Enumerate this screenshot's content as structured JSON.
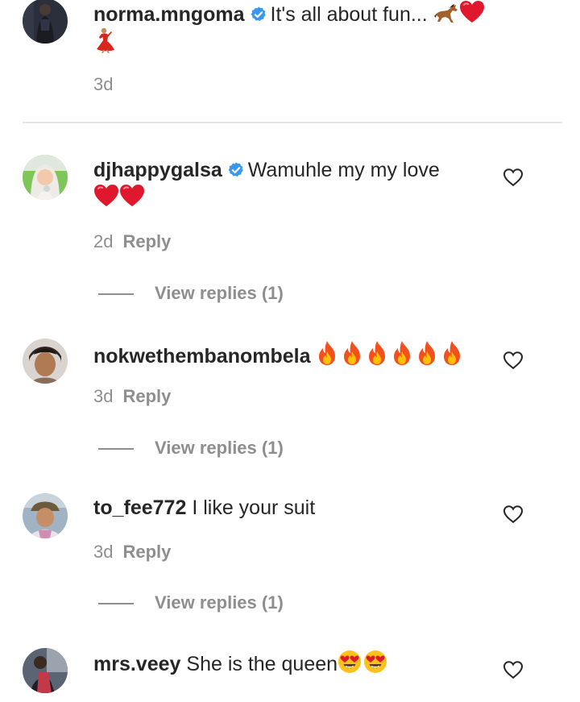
{
  "caption": {
    "username": "norma.mngoma",
    "text": "It's all about fun...",
    "time": "3d"
  },
  "comments": [
    {
      "username": "djhappygalsa",
      "verified": true,
      "text": "Wamuhle my my love",
      "time": "2d",
      "reply": "Reply",
      "view_replies": "View replies (1)"
    },
    {
      "username": "nokwethembanombela",
      "verified": false,
      "text": "",
      "time": "3d",
      "reply": "Reply",
      "view_replies": "View replies (1)"
    },
    {
      "username": "to_fee772",
      "verified": false,
      "text": "I like your suit",
      "time": "3d",
      "reply": "Reply",
      "view_replies": "View replies (1)"
    },
    {
      "username": "mrs.veey",
      "verified": false,
      "text": "She is the queen",
      "time": "",
      "reply": "",
      "view_replies": ""
    }
  ],
  "icons": {
    "verified": "verified-badge-icon",
    "like": "heart-outline-icon",
    "emoji_horse": "horse-emoji",
    "emoji_heart": "red-heart-emoji",
    "emoji_dancer": "dancer-emoji",
    "emoji_fire": "fire-emoji",
    "emoji_heart_eyes": "heart-eyes-emoji"
  },
  "colors": {
    "text": "#262626",
    "secondary": "#8e8e8e",
    "verified": "#3897f0",
    "divider": "#e6e6e6"
  }
}
